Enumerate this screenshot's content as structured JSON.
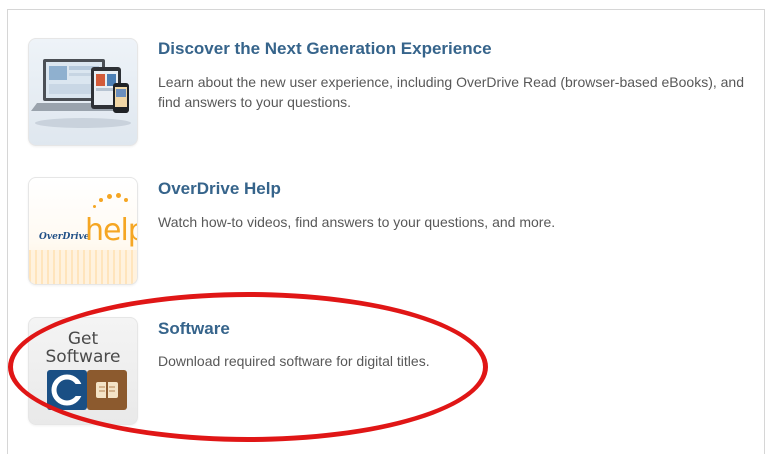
{
  "items": [
    {
      "title": "Discover the Next Generation Experience",
      "description": "Learn about the new user experience, including OverDrive Read (browser-based eBooks), and find answers to your questions.",
      "icon": "devices-icon"
    },
    {
      "title": "OverDrive Help",
      "description": "Watch how-to videos, find answers to your questions, and more.",
      "icon": "overdrive-help-logo",
      "logo_text_brand": "OverDrive",
      "logo_text_help": "help"
    },
    {
      "title": "Software",
      "description": "Download required software for digital titles.",
      "icon": "get-software-icon",
      "logo_text_line1": "Get",
      "logo_text_line2": "Software"
    }
  ],
  "colors": {
    "title": "#36648b",
    "description": "#585858",
    "highlight_ellipse": "#e01616",
    "help_orange": "#f5a623",
    "overdrive_blue": "#1f4f86"
  }
}
